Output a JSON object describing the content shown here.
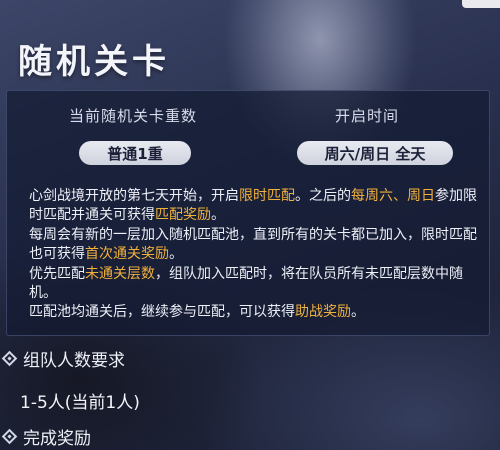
{
  "page": {
    "title": "随机关卡"
  },
  "stats": {
    "level_count_label": "当前随机关卡重数",
    "level_count_value": "普通1重",
    "open_time_label": "开启时间",
    "open_time_value": "周六/周日 全天"
  },
  "description": {
    "segments": [
      {
        "text": "心剑战境开放的第七天开始，开启",
        "highlight": false
      },
      {
        "text": "限时匹配",
        "highlight": true
      },
      {
        "text": "。之后的",
        "highlight": false
      },
      {
        "text": "每周六、周日",
        "highlight": true
      },
      {
        "text": "参加限时匹配并通关可获得",
        "highlight": false
      },
      {
        "text": "匹配奖励",
        "highlight": true
      },
      {
        "text": "。",
        "highlight": false
      },
      {
        "text": "\n每周会有新的一层加入随机匹配池，直到所有的关卡都已加入，限时匹配也可获得",
        "highlight": false
      },
      {
        "text": "首次通关奖励",
        "highlight": true
      },
      {
        "text": "。",
        "highlight": false
      },
      {
        "text": "\n优先匹配",
        "highlight": false
      },
      {
        "text": "未通关层数",
        "highlight": true
      },
      {
        "text": "，组队加入匹配时，将在队员所有未匹配层数中随机。",
        "highlight": false
      },
      {
        "text": "\n匹配池均通关后，继续参与匹配，可以获得",
        "highlight": false
      },
      {
        "text": "助战奖励",
        "highlight": true
      },
      {
        "text": "。",
        "highlight": false
      }
    ]
  },
  "team": {
    "section_label": "组队人数要求",
    "value": "1-5人(当前1人)"
  },
  "rewards": {
    "section_label": "完成奖励"
  },
  "colors": {
    "highlight": "#f0b13c",
    "panel_bg": "#141a32",
    "pill_bg": "#e8eaf0"
  }
}
